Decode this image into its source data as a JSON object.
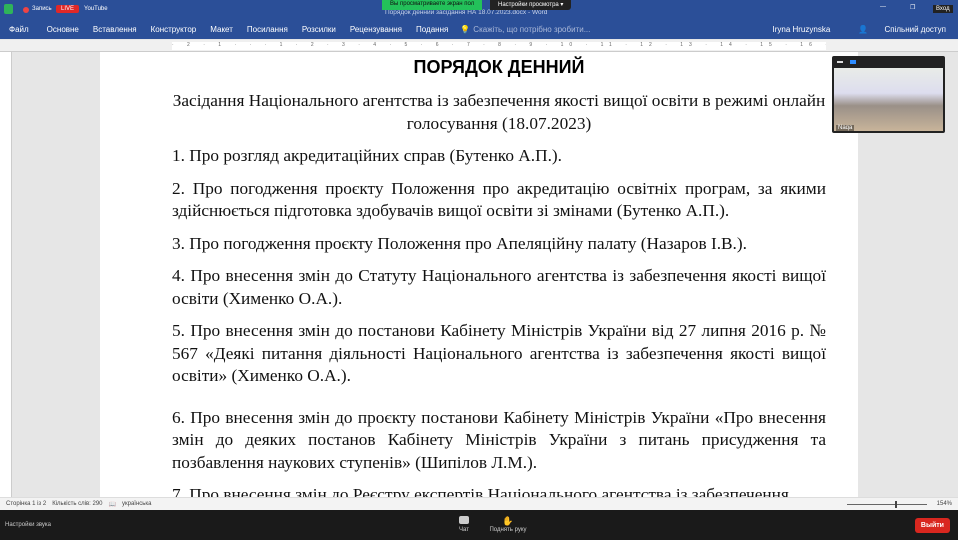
{
  "zoom_top": {
    "recording": "Запись",
    "live": "LIVE",
    "stream": "YouTube",
    "banner": "Вы просматриваете экран пол",
    "view_settings": "Настройки просмотра",
    "login": "Вход"
  },
  "word": {
    "title": "Порядок денний засідання НА 18.07.2023.docx - Word",
    "tabs": [
      "Файл",
      "Основне",
      "Вставлення",
      "Конструктор",
      "Макет",
      "Посилання",
      "Розсилки",
      "Рецензування",
      "Подання"
    ],
    "tell_me": "Скажіть, що потрібно зробити...",
    "user": "Iryna Hruzynska",
    "share": "Спільний доступ",
    "ruler": "· 2 · 1 · · · 1 · 2 · 3 · 4 · 5 · 6 · 7 · 8 · 9 · 10 · 11 · 12 · 13 · 14 · 15 · 16 · 17"
  },
  "document": {
    "heading": "ПОРЯДОК ДЕННИЙ",
    "subtitle": "Засідання Національного агентства із забезпечення якості вищої освіти в режимі онлайн голосування (18.07.2023)",
    "items": [
      "1. Про розгляд акредитаційних справ (Бутенко А.П.).",
      "2. Про погодження проєкту Положення про акредитацію освітніх програм, за якими здійснюється підготовка здобувачів вищої освіти зі змінами (Бутенко А.П.).",
      "3. Про погодження проєкту Положення про Апеляційну палату (Назаров І.В.).",
      "4. Про внесення змін до Статуту Національного агентства із забезпечення якості вищої освіти (Хименко О.А.).",
      "5. Про внесення змін до постанови Кабінету Міністрів України від 27 липня 2016 р. № 567 «Деякі питання діяльності Національного агентства із забезпечення якості вищої освіти» (Хименко О.А.).",
      "6. Про внесення змін до проєкту постанови Кабінету Міністрів України «Про внесення змін до деяких постанов Кабінету Міністрів України з питань присудження та позбавлення наукових ступенів» (Шипілов Л.М.).",
      "7. Про внесення змін до Реєстру експертів Національного агентства із забезпечення"
    ]
  },
  "statusbar": {
    "page": "Сторінка 1 із 2",
    "words": "Кількість слів: 290",
    "language": "українська",
    "zoom": "154%"
  },
  "participant": {
    "name": "Naqa"
  },
  "zoom_bottom": {
    "audio": "Настройки звука",
    "chat": "Чат",
    "raise_hand": "Поднять руку",
    "leave": "Выйти"
  }
}
